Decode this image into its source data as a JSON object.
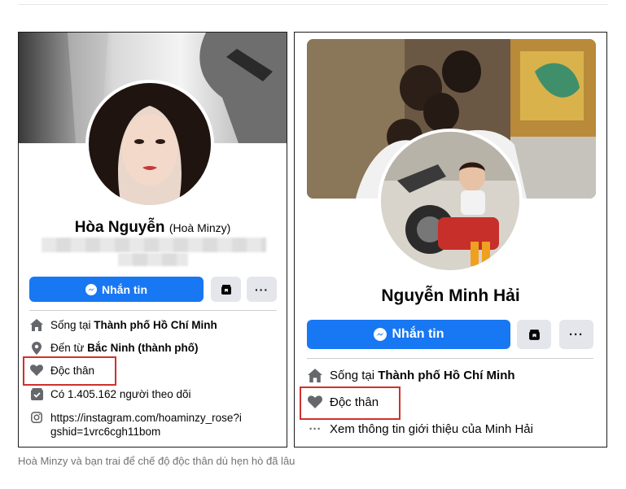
{
  "left_profile": {
    "name": "Hòa Nguyễn",
    "alt_name": "(Hoà Minzy)",
    "message_button": "Nhắn tin",
    "info": {
      "lives_prefix": "Sống tại ",
      "lives_place": "Thành phố Hồ Chí Minh",
      "from_prefix": "Đến từ ",
      "from_place": "Bắc Ninh (thành phố)",
      "relationship": "Độc thân",
      "followers": "Có 1.405.162 người theo dõi",
      "link": "https://instagram.com/hoaminzy_rose?igshid=1vrc6cgh11bom"
    }
  },
  "right_profile": {
    "name": "Nguyễn Minh Hải",
    "message_button": "Nhắn tin",
    "info": {
      "lives_prefix": "Sống tại ",
      "lives_place": "Thành phố Hồ Chí Minh",
      "relationship": "Độc thân",
      "about": "Xem thông tin giới thiệu của Minh Hải"
    }
  },
  "caption": "Hoà Minzy và bạn trai để chế độ độc thân dù hẹn hò đã lâu",
  "colors": {
    "brand_blue": "#1877f2",
    "highlight_red": "#d0312d",
    "icon_gray": "#65676b"
  }
}
